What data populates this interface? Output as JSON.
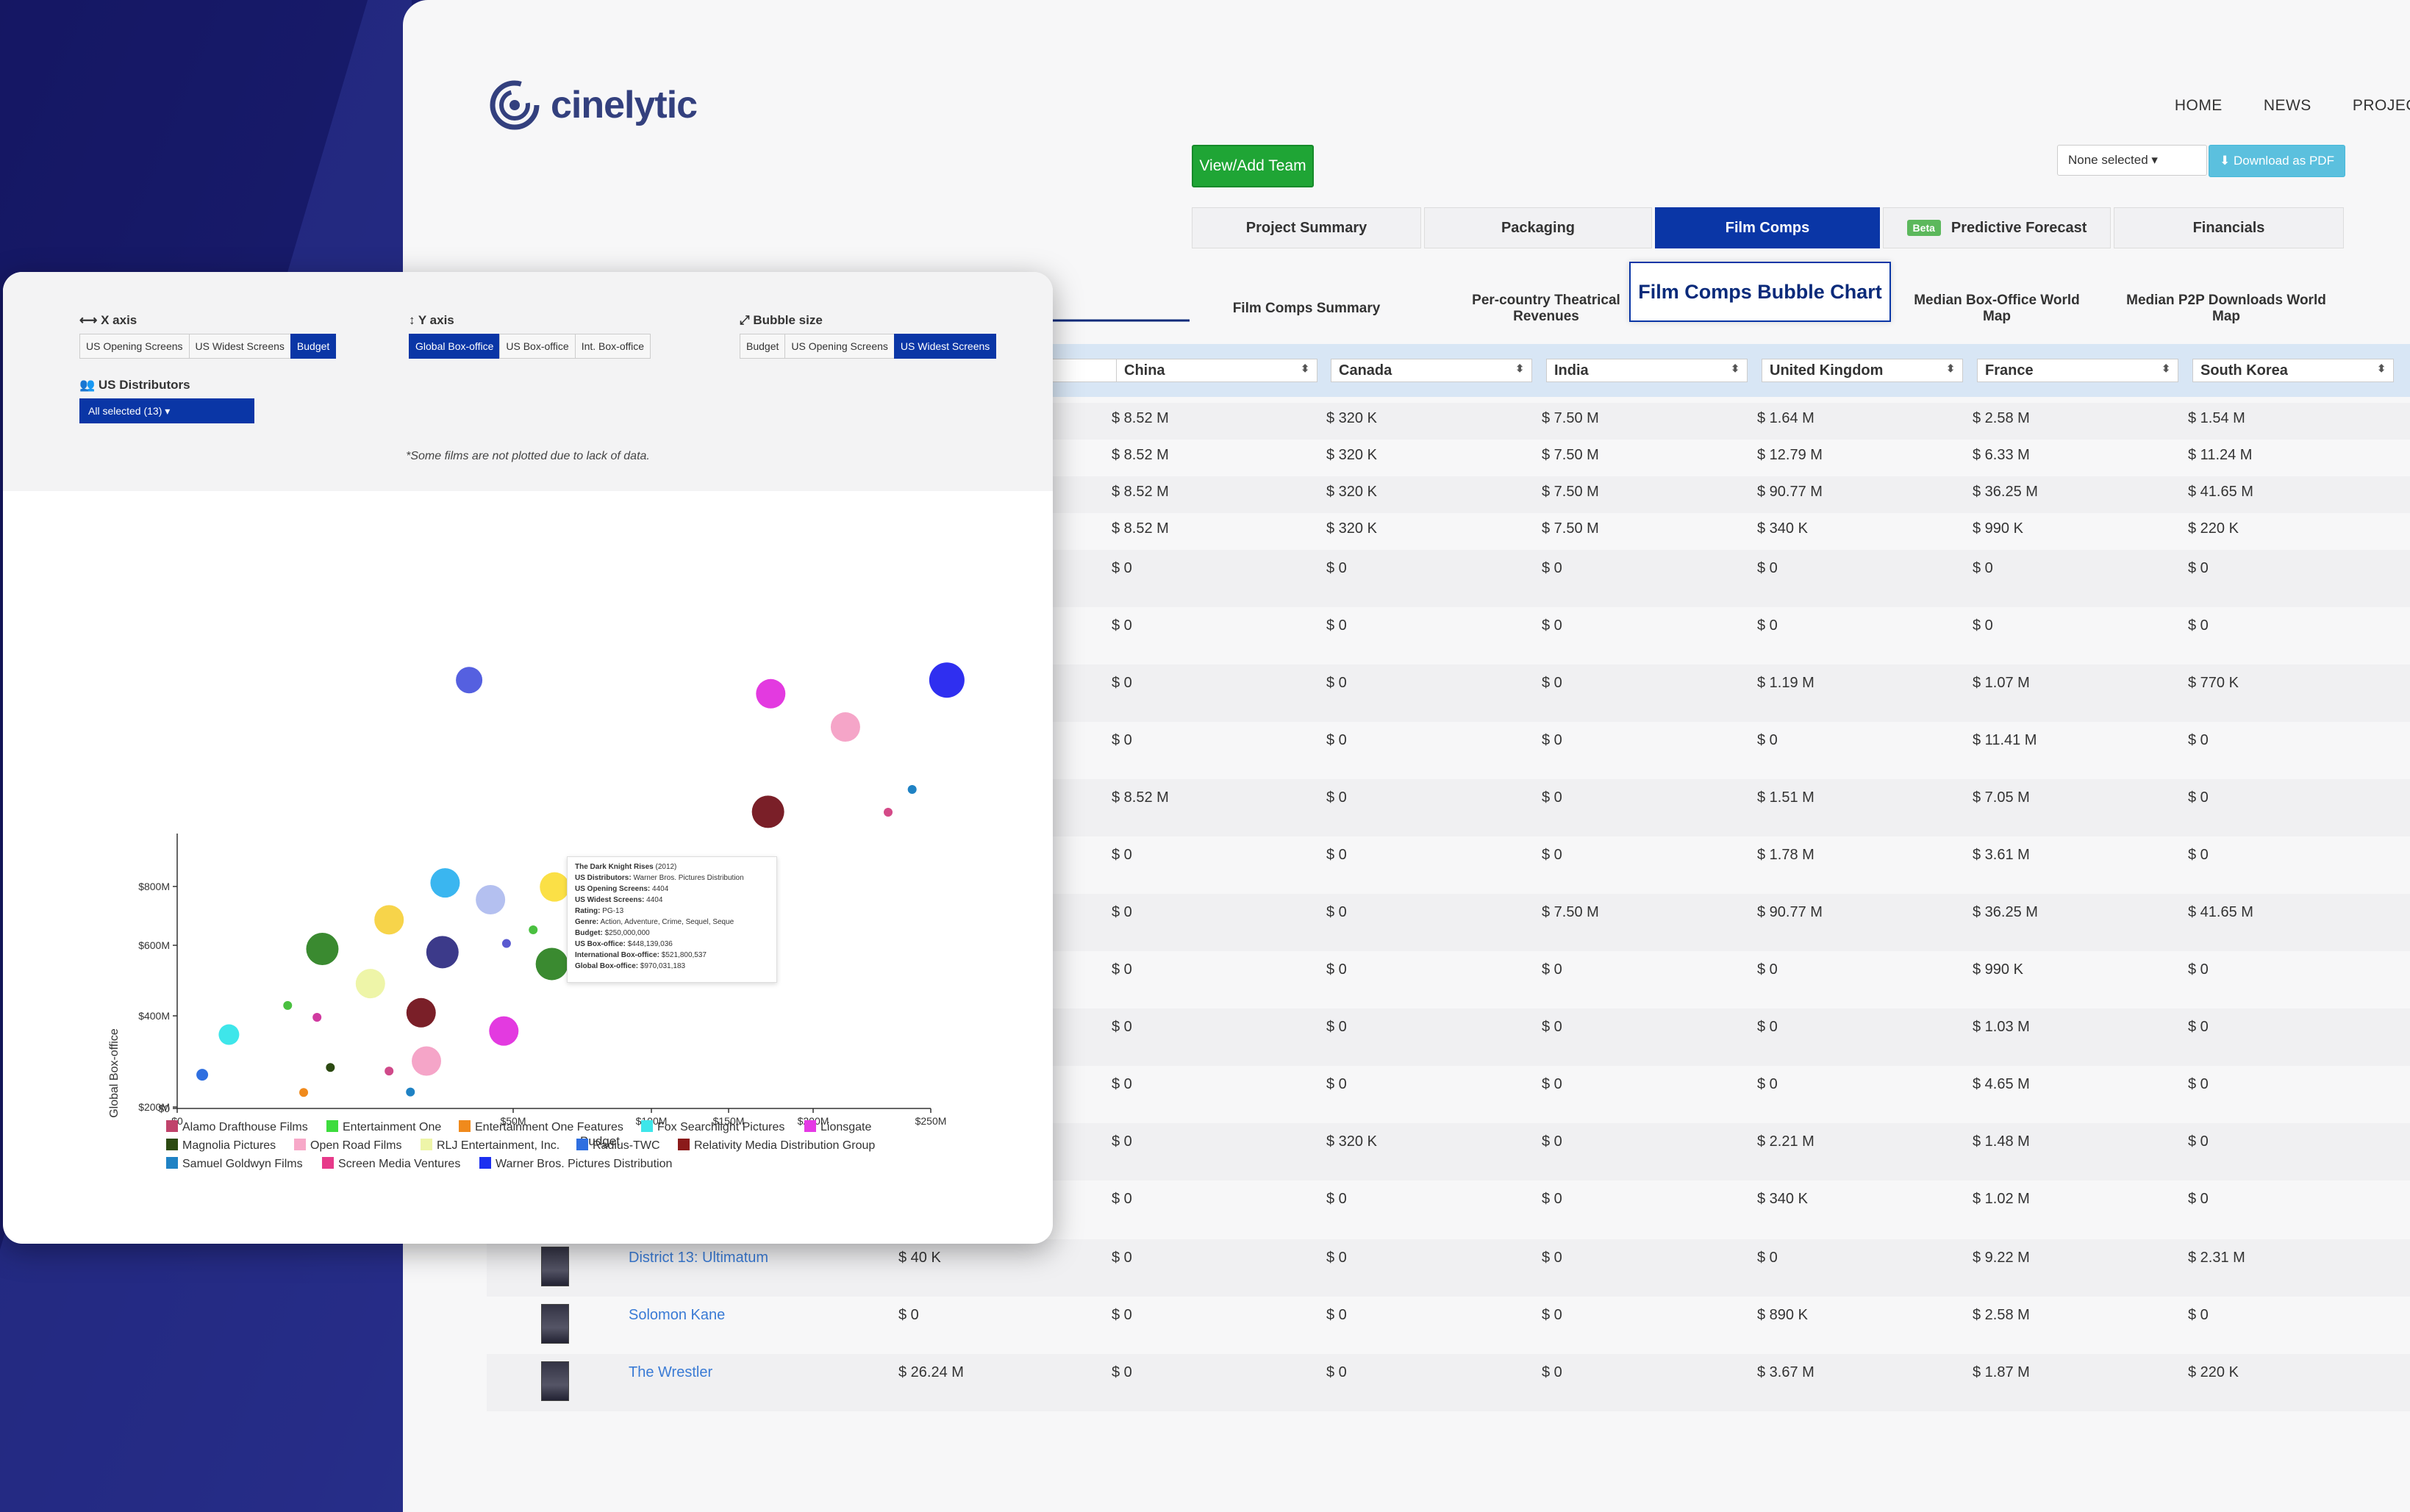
{
  "app": {
    "brand": "cinelytic",
    "nav": [
      "HOME",
      "NEWS",
      "PROJEC"
    ],
    "view_add_team": "View/Add Team",
    "none_selected": "None selected ▾",
    "download_pdf": "⬇ Download as PDF",
    "tabs": [
      "Project Summary",
      "Packaging",
      "Film Comps",
      "Predictive Forecast",
      "Financials"
    ],
    "beta": "Beta",
    "subtabs": [
      "Film Comps Summary",
      "Per-country Theatrical Revenues",
      "Film Comps Bubble Chart",
      "Median Box-Office World Map",
      "Median P2P Downloads World Map"
    ],
    "columns": [
      "China",
      "Canada",
      "India",
      "United Kingdom",
      "France",
      "South Korea"
    ],
    "rows": [
      {
        "film": "",
        "first": "",
        "cells": [
          "$ 8.52 M",
          "$ 320 K",
          "$ 7.50 M",
          "$ 1.64 M",
          "$ 2.58 M",
          "$ 1.54 M"
        ]
      },
      {
        "film": "",
        "first": "",
        "cells": [
          "$ 8.52 M",
          "$ 320 K",
          "$ 7.50 M",
          "$ 12.79 M",
          "$ 6.33 M",
          "$ 11.24 M"
        ]
      },
      {
        "film": "",
        "first": "",
        "cells": [
          "$ 8.52 M",
          "$ 320 K",
          "$ 7.50 M",
          "$ 90.77 M",
          "$ 36.25 M",
          "$ 41.65 M"
        ]
      },
      {
        "film": "",
        "first": "",
        "cells": [
          "$ 8.52 M",
          "$ 320 K",
          "$ 7.50 M",
          "$ 340 K",
          "$ 990 K",
          "$ 220 K"
        ]
      },
      {
        "film": "",
        "first": "",
        "cells": [
          "$ 0",
          "$ 0",
          "$ 0",
          "$ 0",
          "$ 0",
          "$ 0"
        ]
      },
      {
        "film": "",
        "first": "",
        "cells": [
          "$ 0",
          "$ 0",
          "$ 0",
          "$ 0",
          "$ 0",
          "$ 0"
        ]
      },
      {
        "film": "",
        "first": "",
        "cells": [
          "$ 0",
          "$ 0",
          "$ 0",
          "$ 1.19 M",
          "$ 1.07 M",
          "$ 770 K"
        ]
      },
      {
        "film": "",
        "first": "",
        "cells": [
          "$ 0",
          "$ 0",
          "$ 0",
          "$ 0",
          "$ 11.41 M",
          "$ 0"
        ]
      },
      {
        "film": "",
        "first": "",
        "cells": [
          "$ 8.52 M",
          "$ 0",
          "$ 0",
          "$ 1.51 M",
          "$ 7.05 M",
          "$ 0"
        ]
      },
      {
        "film": "",
        "first": "",
        "cells": [
          "$ 0",
          "$ 0",
          "$ 0",
          "$ 1.78 M",
          "$ 3.61 M",
          "$ 0"
        ]
      },
      {
        "film": "",
        "first": "",
        "cells": [
          "$ 0",
          "$ 0",
          "$ 7.50 M",
          "$ 90.77 M",
          "$ 36.25 M",
          "$ 41.65 M"
        ]
      },
      {
        "film": "",
        "first": "",
        "cells": [
          "$ 0",
          "$ 0",
          "$ 0",
          "$ 0",
          "$ 990 K",
          "$ 0"
        ]
      },
      {
        "film": "",
        "first": "",
        "cells": [
          "$ 0",
          "$ 0",
          "$ 0",
          "$ 0",
          "$ 1.03 M",
          "$ 0"
        ]
      },
      {
        "film": "",
        "first": "",
        "cells": [
          "$ 0",
          "$ 0",
          "$ 0",
          "$ 0",
          "$ 4.65 M",
          "$ 0"
        ]
      },
      {
        "film": "",
        "first": "",
        "cells": [
          "$ 0",
          "$ 320 K",
          "$ 0",
          "$ 2.21 M",
          "$ 1.48 M",
          "$ 0"
        ]
      },
      {
        "film": "",
        "first": "",
        "cells": [
          "$ 0",
          "$ 0",
          "$ 0",
          "$ 340 K",
          "$ 1.02 M",
          "$ 0"
        ]
      },
      {
        "film": "District 13: Ultimatum",
        "first": "$ 40 K",
        "cells": [
          "$ 0",
          "$ 0",
          "$ 0",
          "$ 0",
          "$ 9.22 M",
          "$ 2.31 M"
        ]
      },
      {
        "film": "Solomon Kane",
        "first": "$ 0",
        "cells": [
          "$ 0",
          "$ 0",
          "$ 0",
          "$ 890 K",
          "$ 2.58 M",
          "$ 0"
        ]
      },
      {
        "film": "The Wrestler",
        "first": "$ 26.24 M",
        "cells": [
          "$ 0",
          "$ 0",
          "$ 0",
          "$ 3.67 M",
          "$ 1.87 M",
          "$ 220 K"
        ]
      }
    ]
  },
  "card": {
    "x_axis_label": "⟷ X axis",
    "x_opts": [
      "US Opening Screens",
      "US Widest Screens",
      "Budget"
    ],
    "y_axis_label": "↕ Y axis",
    "y_opts": [
      "Global Box-office",
      "US Box-office",
      "Int. Box-office"
    ],
    "bubble_label": "⤢ Bubble size",
    "b_opts": [
      "Budget",
      "US Opening Screens",
      "US Widest Screens"
    ],
    "dist_label": "👥 US Distributors",
    "dist_value": "All selected (13) ▾",
    "note": "*Some films are not plotted due to lack of data."
  },
  "tooltip": {
    "title": "The Dark Knight Rises",
    "year": "(2012)",
    "lines": [
      [
        "US Distributors:",
        "Warner Bros. Pictures Distribution"
      ],
      [
        "US Opening Screens:",
        "4404"
      ],
      [
        "US Widest Screens:",
        "4404"
      ],
      [
        "Rating:",
        "PG-13"
      ],
      [
        "Genre:",
        "Action, Adventure, Crime, Sequel, Seque"
      ],
      [
        "Budget:",
        "$250,000,000"
      ],
      [
        "US Box-office:",
        "$448,139,036"
      ],
      [
        "International Box-office:",
        "$521,800,537"
      ],
      [
        "Global Box-office:",
        "$970,031,183"
      ]
    ]
  },
  "chart_data": {
    "type": "scatter",
    "xlabel": "Budget",
    "ylabel": "Global Box-office",
    "x_ticks": [
      "$0",
      "$50M",
      "$100M",
      "$150M",
      "$200M",
      "$250M"
    ],
    "y_ticks": [
      "$0",
      "$200M",
      "$400M",
      "$600M",
      "$800M"
    ],
    "x_tick_values": [
      0,
      50,
      100,
      150,
      200,
      250
    ],
    "y_tick_values": [
      0,
      200,
      400,
      600,
      800
    ],
    "xlim": [
      0,
      250
    ],
    "ylim": [
      0,
      900
    ],
    "legend": [
      {
        "name": "Alamo Drafthouse Films",
        "color": "#c0436b"
      },
      {
        "name": "Entertainment One",
        "color": "#3ddc3d"
      },
      {
        "name": "Entertainment One Features",
        "color": "#f08a1c"
      },
      {
        "name": "Fox Searchlight Pictures",
        "color": "#3ee6ea"
      },
      {
        "name": "Lionsgate",
        "color": "#e53ae5"
      },
      {
        "name": "Magnolia Pictures",
        "color": "#2c4a12"
      },
      {
        "name": "Open Road Films",
        "color": "#f7a8c8"
      },
      {
        "name": "RLJ Entertainment, Inc.",
        "color": "#eef5a8"
      },
      {
        "name": "Radius-TWC",
        "color": "#2f6fe0"
      },
      {
        "name": "Relativity Media Distribution Group",
        "color": "#8b1a1a"
      },
      {
        "name": "Samuel Goldwyn Films",
        "color": "#1f82c4"
      },
      {
        "name": "Screen Media Ventures",
        "color": "#e73a8a"
      },
      {
        "name": "Warner Bros. Pictures Distribution",
        "color": "#1c2ff0"
      }
    ],
    "points": [
      {
        "x": 70,
        "y": 940,
        "s": 9,
        "c": "#5560e0"
      },
      {
        "x": 183,
        "y": 910,
        "s": 10,
        "c": "#e33ae0"
      },
      {
        "x": 249,
        "y": 940,
        "s": 12,
        "c": "#2f2ff0"
      },
      {
        "x": 211,
        "y": 837,
        "s": 10,
        "c": "#f5a5c8"
      },
      {
        "x": 236,
        "y": 700,
        "s": 3,
        "c": "#1f82c4"
      },
      {
        "x": 182,
        "y": 651,
        "s": 11,
        "c": "#7a1f28"
      },
      {
        "x": 227,
        "y": 650,
        "s": 3,
        "c": "#d44a88"
      },
      {
        "x": 135,
        "y": 500,
        "s": 12,
        "c": "#ee2a30"
      },
      {
        "x": 102,
        "y": 486,
        "s": 10,
        "c": "#fbe046"
      },
      {
        "x": 61,
        "y": 495,
        "s": 10,
        "c": "#3ab6f0"
      },
      {
        "x": 78,
        "y": 458,
        "s": 10,
        "c": "#b4c0f0"
      },
      {
        "x": 40,
        "y": 414,
        "s": 10,
        "c": "#f7d44a"
      },
      {
        "x": 115,
        "y": 408,
        "s": 10,
        "c": "#eef5a8"
      },
      {
        "x": 94,
        "y": 392,
        "s": 3,
        "c": "#4ac040"
      },
      {
        "x": 15,
        "y": 350,
        "s": 11,
        "c": "#3a8a30"
      },
      {
        "x": 60,
        "y": 343,
        "s": 11,
        "c": "#3c3a8a"
      },
      {
        "x": 84,
        "y": 362,
        "s": 3,
        "c": "#5a5ad0"
      },
      {
        "x": 149,
        "y": 350,
        "s": 3,
        "c": "#d03aa0"
      },
      {
        "x": 101,
        "y": 317,
        "s": 11,
        "c": "#3a8a30"
      },
      {
        "x": 144,
        "y": 297,
        "s": 3,
        "c": "#4ac040"
      },
      {
        "x": 33,
        "y": 274,
        "s": 10,
        "c": "#eef5a8"
      },
      {
        "x": 2,
        "y": 226,
        "s": 3,
        "c": "#4ac040"
      },
      {
        "x": 52,
        "y": 210,
        "s": 10,
        "c": "#7a1f28"
      },
      {
        "x": 13,
        "y": 200,
        "s": 3,
        "c": "#d03aa0"
      },
      {
        "x": 83,
        "y": 170,
        "s": 10,
        "c": "#e33ae0"
      },
      {
        "x": -20,
        "y": 162,
        "s": 7,
        "c": "#3ee6ea"
      },
      {
        "x": 54,
        "y": 104,
        "s": 10,
        "c": "#f5a5c8"
      },
      {
        "x": 18,
        "y": 90,
        "s": 3,
        "c": "#2c4a12"
      },
      {
        "x": 40,
        "y": 82,
        "s": 3,
        "c": "#d04a8a"
      },
      {
        "x": -30,
        "y": 74,
        "s": 4,
        "c": "#2f6fe0"
      },
      {
        "x": 8,
        "y": 35,
        "s": 3,
        "c": "#f08a1c"
      },
      {
        "x": 48,
        "y": 36,
        "s": 3,
        "c": "#1f82c4"
      }
    ]
  }
}
